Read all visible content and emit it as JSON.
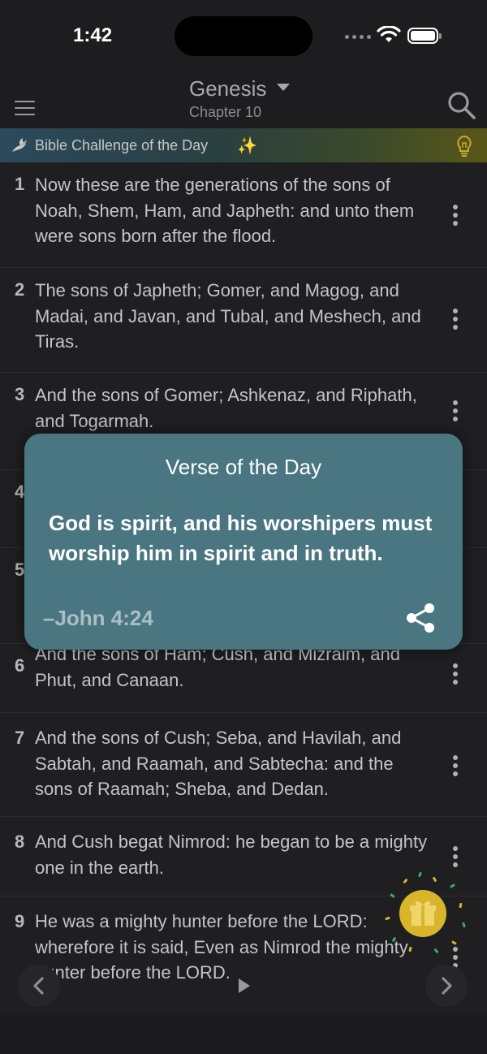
{
  "status_bar": {
    "time": "1:42"
  },
  "header": {
    "book": "Genesis",
    "chapter": "Chapter 10"
  },
  "challenge": {
    "label": "Bible Challenge of the Day",
    "sparkle": "✨"
  },
  "verses": [
    {
      "num": "1",
      "text": "Now these are the generations of the sons of Noah, Shem, Ham, and Japheth: and unto them were sons born after the flood."
    },
    {
      "num": "2",
      "text": "The sons of Japheth; Gomer, and Magog, and Madai, and Javan, and Tubal, and Meshech, and Tiras."
    },
    {
      "num": "3",
      "text": "And the sons of Gomer; Ashkenaz, and Riphath, and Togarmah."
    },
    {
      "num": "4",
      "text": ""
    },
    {
      "num": "5",
      "text": ""
    },
    {
      "num": "6",
      "text": "And the sons of Ham; Cush, and Mizraim, and Phut, and Canaan."
    },
    {
      "num": "7",
      "text": "And the sons of Cush; Seba, and Havilah, and Sabtah, and Raamah, and Sabtecha: and the sons of Raamah; Sheba, and Dedan."
    },
    {
      "num": "8",
      "text": "And Cush begat Nimrod: he began to be a mighty one in the earth."
    },
    {
      "num": "9",
      "text": "He was a mighty hunter before the LORD: wherefore it is said, Even as Nimrod the mighty hunter before the LORD."
    }
  ],
  "verse_of_the_day": {
    "title": "Verse of the Day",
    "text": "God is spirit, and his worshipers must worship him in spirit and in truth.",
    "reference": "–John 4:24"
  },
  "icons": {
    "menu": "menu-icon",
    "search": "search-icon",
    "dove": "dove-icon",
    "bulb": "lightbulb-icon",
    "share": "share-icon",
    "gift": "gift-icon",
    "prev": "chevron-left-icon",
    "play": "play-icon",
    "next": "chevron-right-icon"
  },
  "colors": {
    "background": "#1d1d1f",
    "popup": "#4a7682",
    "gift": "#d8b52a"
  }
}
